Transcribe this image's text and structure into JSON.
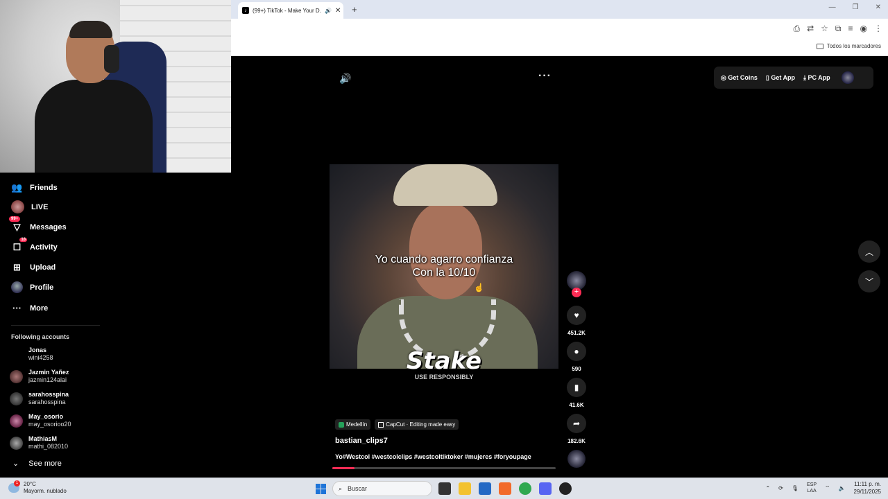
{
  "browser": {
    "tab_title": "(99+) TikTok - Make Your D...",
    "new_tab": "+",
    "bookmarks_label": "Todos los marcadores"
  },
  "nav": {
    "items": [
      {
        "label": "Friends",
        "icon": "friends-icon"
      },
      {
        "label": "LIVE",
        "icon": "live-avatar"
      },
      {
        "label": "Messages",
        "icon": "messages-icon",
        "badge": "99+"
      },
      {
        "label": "Activity",
        "icon": "activity-icon",
        "badge": "18"
      },
      {
        "label": "Upload",
        "icon": "upload-icon"
      },
      {
        "label": "Profile",
        "icon": "profile-avatar"
      },
      {
        "label": "More",
        "icon": "more-icon"
      }
    ],
    "following_title": "Following accounts",
    "accounts": [
      {
        "name": "Jonas",
        "user": "wini4258"
      },
      {
        "name": "Jazmin Yañez",
        "user": "jazmin124alai"
      },
      {
        "name": "sarahosspina",
        "user": "sarahosspina"
      },
      {
        "name": "May_osorio",
        "user": "may_osorioo20"
      },
      {
        "name": "MathiasM",
        "user": "mathi_082010"
      }
    ],
    "see_more": "See more"
  },
  "top_actions": {
    "get_coins": "Get Coins",
    "get_app": "Get App",
    "pc_app": "PC App"
  },
  "video": {
    "caption_line1": "Yo cuando agarro confianza",
    "caption_line2": "Con la 10/10",
    "sponsor": "Stake",
    "sponsor_sub": "USE RESPONSIBLY",
    "tag_location": "Medellín",
    "tag_capcut": "CapCut · Editing made easy",
    "author": "bastian_clips7",
    "description": "Yo#Westcol #westcolclips #westcoltiktoker #mujeres #foryoupage",
    "progress": 0.1
  },
  "actions": {
    "likes": "451.2K",
    "comments": "590",
    "saves": "41.6K",
    "shares": "182.6K"
  },
  "taskbar": {
    "temp": "20°C",
    "weather": "Mayorm. nublado",
    "weather_badge": "1",
    "search_placeholder": "Buscar",
    "lang1": "ESP",
    "lang2": "LAA",
    "time": "11:11 p. m.",
    "date": "29/11/2025"
  }
}
